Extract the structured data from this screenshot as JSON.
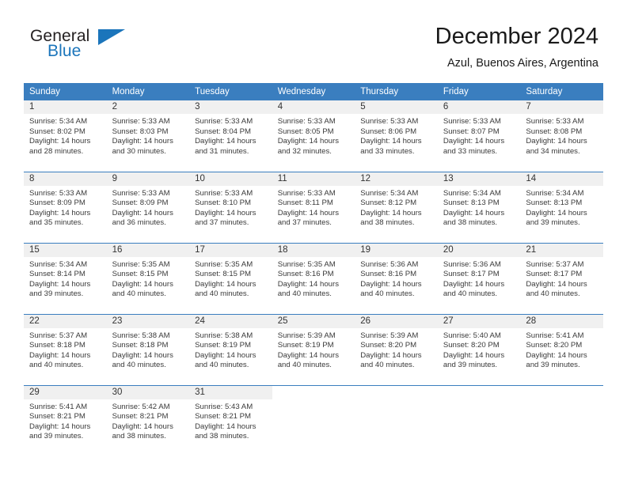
{
  "brand": {
    "name_part1": "General",
    "name_part2": "Blue",
    "logo_icon": "triangle-flag-icon"
  },
  "header": {
    "title": "December 2024",
    "subtitle": "Azul, Buenos Aires, Argentina"
  },
  "theme": {
    "header_blue": "#3a7ebf",
    "brand_blue": "#1b75bb",
    "daynum_band": "#f0f0f0",
    "text": "#3a3a3a"
  },
  "calendar": {
    "weekday_headers": [
      "Sunday",
      "Monday",
      "Tuesday",
      "Wednesday",
      "Thursday",
      "Friday",
      "Saturday"
    ],
    "labels": {
      "sunrise": "Sunrise:",
      "sunset": "Sunset:",
      "daylight": "Daylight:"
    },
    "weeks": [
      [
        {
          "day": "1",
          "sunrise": "Sunrise: 5:34 AM",
          "sunset": "Sunset: 8:02 PM",
          "daylight_line1": "Daylight: 14 hours",
          "daylight_line2": "and 28 minutes."
        },
        {
          "day": "2",
          "sunrise": "Sunrise: 5:33 AM",
          "sunset": "Sunset: 8:03 PM",
          "daylight_line1": "Daylight: 14 hours",
          "daylight_line2": "and 30 minutes."
        },
        {
          "day": "3",
          "sunrise": "Sunrise: 5:33 AM",
          "sunset": "Sunset: 8:04 PM",
          "daylight_line1": "Daylight: 14 hours",
          "daylight_line2": "and 31 minutes."
        },
        {
          "day": "4",
          "sunrise": "Sunrise: 5:33 AM",
          "sunset": "Sunset: 8:05 PM",
          "daylight_line1": "Daylight: 14 hours",
          "daylight_line2": "and 32 minutes."
        },
        {
          "day": "5",
          "sunrise": "Sunrise: 5:33 AM",
          "sunset": "Sunset: 8:06 PM",
          "daylight_line1": "Daylight: 14 hours",
          "daylight_line2": "and 33 minutes."
        },
        {
          "day": "6",
          "sunrise": "Sunrise: 5:33 AM",
          "sunset": "Sunset: 8:07 PM",
          "daylight_line1": "Daylight: 14 hours",
          "daylight_line2": "and 33 minutes."
        },
        {
          "day": "7",
          "sunrise": "Sunrise: 5:33 AM",
          "sunset": "Sunset: 8:08 PM",
          "daylight_line1": "Daylight: 14 hours",
          "daylight_line2": "and 34 minutes."
        }
      ],
      [
        {
          "day": "8",
          "sunrise": "Sunrise: 5:33 AM",
          "sunset": "Sunset: 8:09 PM",
          "daylight_line1": "Daylight: 14 hours",
          "daylight_line2": "and 35 minutes."
        },
        {
          "day": "9",
          "sunrise": "Sunrise: 5:33 AM",
          "sunset": "Sunset: 8:09 PM",
          "daylight_line1": "Daylight: 14 hours",
          "daylight_line2": "and 36 minutes."
        },
        {
          "day": "10",
          "sunrise": "Sunrise: 5:33 AM",
          "sunset": "Sunset: 8:10 PM",
          "daylight_line1": "Daylight: 14 hours",
          "daylight_line2": "and 37 minutes."
        },
        {
          "day": "11",
          "sunrise": "Sunrise: 5:33 AM",
          "sunset": "Sunset: 8:11 PM",
          "daylight_line1": "Daylight: 14 hours",
          "daylight_line2": "and 37 minutes."
        },
        {
          "day": "12",
          "sunrise": "Sunrise: 5:34 AM",
          "sunset": "Sunset: 8:12 PM",
          "daylight_line1": "Daylight: 14 hours",
          "daylight_line2": "and 38 minutes."
        },
        {
          "day": "13",
          "sunrise": "Sunrise: 5:34 AM",
          "sunset": "Sunset: 8:13 PM",
          "daylight_line1": "Daylight: 14 hours",
          "daylight_line2": "and 38 minutes."
        },
        {
          "day": "14",
          "sunrise": "Sunrise: 5:34 AM",
          "sunset": "Sunset: 8:13 PM",
          "daylight_line1": "Daylight: 14 hours",
          "daylight_line2": "and 39 minutes."
        }
      ],
      [
        {
          "day": "15",
          "sunrise": "Sunrise: 5:34 AM",
          "sunset": "Sunset: 8:14 PM",
          "daylight_line1": "Daylight: 14 hours",
          "daylight_line2": "and 39 minutes."
        },
        {
          "day": "16",
          "sunrise": "Sunrise: 5:35 AM",
          "sunset": "Sunset: 8:15 PM",
          "daylight_line1": "Daylight: 14 hours",
          "daylight_line2": "and 40 minutes."
        },
        {
          "day": "17",
          "sunrise": "Sunrise: 5:35 AM",
          "sunset": "Sunset: 8:15 PM",
          "daylight_line1": "Daylight: 14 hours",
          "daylight_line2": "and 40 minutes."
        },
        {
          "day": "18",
          "sunrise": "Sunrise: 5:35 AM",
          "sunset": "Sunset: 8:16 PM",
          "daylight_line1": "Daylight: 14 hours",
          "daylight_line2": "and 40 minutes."
        },
        {
          "day": "19",
          "sunrise": "Sunrise: 5:36 AM",
          "sunset": "Sunset: 8:16 PM",
          "daylight_line1": "Daylight: 14 hours",
          "daylight_line2": "and 40 minutes."
        },
        {
          "day": "20",
          "sunrise": "Sunrise: 5:36 AM",
          "sunset": "Sunset: 8:17 PM",
          "daylight_line1": "Daylight: 14 hours",
          "daylight_line2": "and 40 minutes."
        },
        {
          "day": "21",
          "sunrise": "Sunrise: 5:37 AM",
          "sunset": "Sunset: 8:17 PM",
          "daylight_line1": "Daylight: 14 hours",
          "daylight_line2": "and 40 minutes."
        }
      ],
      [
        {
          "day": "22",
          "sunrise": "Sunrise: 5:37 AM",
          "sunset": "Sunset: 8:18 PM",
          "daylight_line1": "Daylight: 14 hours",
          "daylight_line2": "and 40 minutes."
        },
        {
          "day": "23",
          "sunrise": "Sunrise: 5:38 AM",
          "sunset": "Sunset: 8:18 PM",
          "daylight_line1": "Daylight: 14 hours",
          "daylight_line2": "and 40 minutes."
        },
        {
          "day": "24",
          "sunrise": "Sunrise: 5:38 AM",
          "sunset": "Sunset: 8:19 PM",
          "daylight_line1": "Daylight: 14 hours",
          "daylight_line2": "and 40 minutes."
        },
        {
          "day": "25",
          "sunrise": "Sunrise: 5:39 AM",
          "sunset": "Sunset: 8:19 PM",
          "daylight_line1": "Daylight: 14 hours",
          "daylight_line2": "and 40 minutes."
        },
        {
          "day": "26",
          "sunrise": "Sunrise: 5:39 AM",
          "sunset": "Sunset: 8:20 PM",
          "daylight_line1": "Daylight: 14 hours",
          "daylight_line2": "and 40 minutes."
        },
        {
          "day": "27",
          "sunrise": "Sunrise: 5:40 AM",
          "sunset": "Sunset: 8:20 PM",
          "daylight_line1": "Daylight: 14 hours",
          "daylight_line2": "and 39 minutes."
        },
        {
          "day": "28",
          "sunrise": "Sunrise: 5:41 AM",
          "sunset": "Sunset: 8:20 PM",
          "daylight_line1": "Daylight: 14 hours",
          "daylight_line2": "and 39 minutes."
        }
      ],
      [
        {
          "day": "29",
          "sunrise": "Sunrise: 5:41 AM",
          "sunset": "Sunset: 8:21 PM",
          "daylight_line1": "Daylight: 14 hours",
          "daylight_line2": "and 39 minutes."
        },
        {
          "day": "30",
          "sunrise": "Sunrise: 5:42 AM",
          "sunset": "Sunset: 8:21 PM",
          "daylight_line1": "Daylight: 14 hours",
          "daylight_line2": "and 38 minutes."
        },
        {
          "day": "31",
          "sunrise": "Sunrise: 5:43 AM",
          "sunset": "Sunset: 8:21 PM",
          "daylight_line1": "Daylight: 14 hours",
          "daylight_line2": "and 38 minutes."
        },
        {
          "day": "",
          "sunrise": "",
          "sunset": "",
          "daylight_line1": "",
          "daylight_line2": ""
        },
        {
          "day": "",
          "sunrise": "",
          "sunset": "",
          "daylight_line1": "",
          "daylight_line2": ""
        },
        {
          "day": "",
          "sunrise": "",
          "sunset": "",
          "daylight_line1": "",
          "daylight_line2": ""
        },
        {
          "day": "",
          "sunrise": "",
          "sunset": "",
          "daylight_line1": "",
          "daylight_line2": ""
        }
      ]
    ]
  }
}
